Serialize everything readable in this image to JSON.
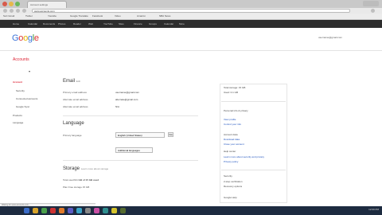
{
  "browser": {
    "tab_title": "Account settings",
    "url": "www.accounts.com",
    "bookmarks": [
      "Sort Gmail",
      "Twitter",
      "Youtube",
      "Google Translate",
      "Facebook",
      "Video",
      "Amazon",
      "NBA News"
    ]
  },
  "gbar": {
    "items": [
      "Home",
      "Calendar",
      "Documents",
      "Photos",
      "Reader",
      "Web",
      "YouTube",
      "Sites",
      "Finance",
      "Groups",
      "Calendar",
      "More"
    ]
  },
  "header": {
    "logo_parts": [
      "G",
      "o",
      "o",
      "g",
      "l",
      "e"
    ],
    "user_email": "username@gmail.com"
  },
  "page": {
    "title": "Accounts"
  },
  "leftnav": {
    "items": [
      {
        "label": "Account",
        "active": true
      },
      {
        "label": "Security",
        "sub": true
      },
      {
        "label": "Connected accounts",
        "sub": true
      },
      {
        "label": "Google Sync",
        "sub": true
      },
      {
        "label": "Products",
        "active": false
      },
      {
        "label": "Language",
        "active": false
      }
    ]
  },
  "email_section": {
    "heading": "Email",
    "edit": "Edit",
    "rows": [
      {
        "label": "Primary email address",
        "value": "username@gmail.com"
      },
      {
        "label": "Alternate email address",
        "value": "alternate@gmail.com"
      },
      {
        "label": "Alternate email address",
        "value": "N/A"
      }
    ]
  },
  "language_section": {
    "heading": "Language",
    "rows": [
      {
        "label": "Primary language",
        "value": "English (United States)"
      },
      {
        "label": "",
        "value": "Additional languages"
      }
    ],
    "button": "Go"
  },
  "storage_section": {
    "heading": "Storage",
    "subheading": "Learn more about storage",
    "rows": [
      {
        "label": "Total used",
        "value": "0.1 GB of 15 GB used"
      },
      {
        "label": "Plan",
        "value": "Free storage 15 GB"
      }
    ]
  },
  "right_panel": {
    "block1": [
      "Total storage: 15 GB",
      "Used: 0.1 GB"
    ],
    "block2_title": "Personal info & privacy",
    "block2": [
      "View profile",
      "Control your info"
    ],
    "block3_title": "Account data",
    "block3_links": [
      "Download data",
      "Close your account"
    ],
    "block4_title": "Help center",
    "block4": [
      "Learn more about security and privacy",
      "Privacy policy"
    ],
    "block5_title": "Security",
    "block5": [
      "2-step verification",
      "Recovery options"
    ],
    "footer": "Google Help"
  },
  "statusbar": {
    "text": "Waiting for www.accounts.com..."
  },
  "taskbar": {
    "clock": "12:00 PM",
    "icon_colors": [
      "#3b6cc7",
      "#d8a42b",
      "#4aa04a",
      "#c33",
      "#e07a2b",
      "#5b5bc4",
      "#3aa3c7",
      "#888888",
      "#c94fa4",
      "#2f8f8f",
      "#d4c32d",
      "#556b2f"
    ]
  }
}
